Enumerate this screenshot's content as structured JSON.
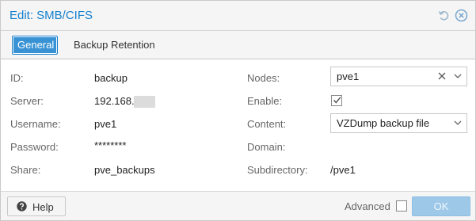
{
  "window": {
    "title": "Edit: SMB/CIFS"
  },
  "tools": {
    "reset_icon": "reset-icon",
    "close_icon": "close-icon"
  },
  "tabs": [
    {
      "label": "General",
      "active": true
    },
    {
      "label": "Backup Retention",
      "active": false
    }
  ],
  "form": {
    "left": [
      {
        "label": "ID:",
        "value": "backup"
      },
      {
        "label": "Server:",
        "value": "192.168."
      },
      {
        "label": "Username:",
        "value": "pve1"
      },
      {
        "label": "Password:",
        "value": "********"
      },
      {
        "label": "Share:",
        "value": "pve_backups"
      }
    ],
    "right": {
      "nodes": {
        "label": "Nodes:",
        "value": "pve1"
      },
      "enable": {
        "label": "Enable:",
        "checked": true
      },
      "content": {
        "label": "Content:",
        "value": "VZDump backup file"
      },
      "domain": {
        "label": "Domain:",
        "value": ""
      },
      "subdirectory": {
        "label": "Subdirectory:",
        "value": "/pve1"
      }
    }
  },
  "footer": {
    "help_label": "Help",
    "advanced_label": "Advanced",
    "advanced_checked": false,
    "ok_label": "OK"
  },
  "colors": {
    "accent": "#157fcc",
    "tab_active": "#3892d4",
    "ok_disabled": "#9ec8e8"
  }
}
